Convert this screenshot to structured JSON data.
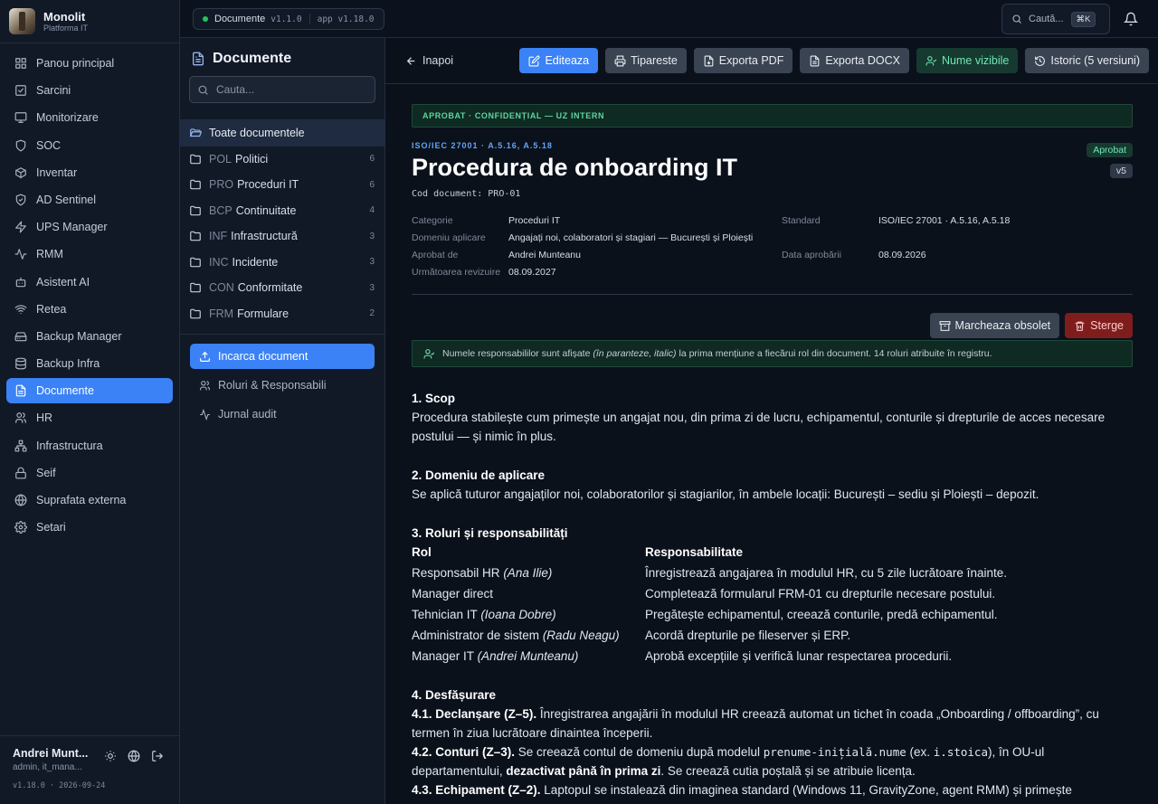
{
  "brand": {
    "name": "Monolit",
    "subtitle": "Platforma IT"
  },
  "nav": [
    {
      "label": "Panou principal",
      "icon": "grid-icon"
    },
    {
      "label": "Sarcini",
      "icon": "checkbox-icon"
    },
    {
      "label": "Monitorizare",
      "icon": "monitor-icon"
    },
    {
      "label": "SOC",
      "icon": "shield-icon"
    },
    {
      "label": "Inventar",
      "icon": "box-icon"
    },
    {
      "label": "AD Sentinel",
      "icon": "shield-check-icon"
    },
    {
      "label": "UPS Manager",
      "icon": "zap-icon"
    },
    {
      "label": "RMM",
      "icon": "activity-icon"
    },
    {
      "label": "Asistent AI",
      "icon": "bot-icon"
    },
    {
      "label": "Retea",
      "icon": "wifi-icon"
    },
    {
      "label": "Backup Manager",
      "icon": "hard-drive-icon"
    },
    {
      "label": "Backup Infra",
      "icon": "database-icon"
    },
    {
      "label": "Documente",
      "icon": "document-icon",
      "active": true
    },
    {
      "label": "HR",
      "icon": "users-icon"
    },
    {
      "label": "Infrastructura",
      "icon": "network-icon"
    },
    {
      "label": "Seif",
      "icon": "lock-icon"
    },
    {
      "label": "Suprafata externa",
      "icon": "globe-icon"
    },
    {
      "label": "Setari",
      "icon": "gear-icon"
    }
  ],
  "user": {
    "name": "Andrei Munt...",
    "role": "admin, it_mana...",
    "version": "v1.18.0 · 2026-09-24"
  },
  "topbar": {
    "section": "Documente",
    "module_version": "v1.1.0",
    "app_version": "app v1.18.0",
    "search_placeholder": "Caută...",
    "shortcut": "⌘K"
  },
  "panel": {
    "title": "Documente",
    "search_placeholder": "Cauta...",
    "all_label": "Toate documentele",
    "folders": [
      {
        "prefix": "POL",
        "name": "Politici",
        "count": "6"
      },
      {
        "prefix": "PRO",
        "name": "Proceduri IT",
        "count": "6"
      },
      {
        "prefix": "BCP",
        "name": "Continuitate",
        "count": "4"
      },
      {
        "prefix": "INF",
        "name": "Infrastructură",
        "count": "3"
      },
      {
        "prefix": "INC",
        "name": "Incidente",
        "count": "3"
      },
      {
        "prefix": "CON",
        "name": "Conformitate",
        "count": "3"
      },
      {
        "prefix": "FRM",
        "name": "Formulare",
        "count": "2"
      }
    ],
    "upload_label": "Incarca document",
    "roles_label": "Roluri & Responsabili",
    "audit_label": "Jurnal audit"
  },
  "toolbar": {
    "back": "Inapoi",
    "edit": "Editeaza",
    "print": "Tipareste",
    "pdf": "Exporta PDF",
    "docx": "Exporta DOCX",
    "names": "Nume vizibile",
    "history": "Istoric (5 versiuni)"
  },
  "doc": {
    "banner": "APROBAT · CONFIDENȚIAL — UZ INTERN",
    "iso": "ISO/IEC 27001 · A.5.16, A.5.18",
    "title": "Procedura de onboarding IT",
    "code": "Cod document: PRO-01",
    "status": "Aprobat",
    "version": "v5",
    "meta": {
      "cat_k": "Categorie",
      "cat_v": "Proceduri IT",
      "std_k": "Standard",
      "std_v": "ISO/IEC 27001 · A.5.16, A.5.18",
      "dom_k": "Domeniu aplicare",
      "dom_v": "Angajați noi, colaboratori și stagiari — București și Ploiești",
      "appr_k": "Aprobat de",
      "appr_v": "Andrei Munteanu",
      "date_k": "Data aprobării",
      "date_v": "08.09.2026",
      "next_k": "Următoarea revizuire",
      "next_v": "08.09.2027"
    },
    "obsolete": "Marcheaza obsolet",
    "delete": "Sterge",
    "info_a": "Numele responsabililor sunt afișate ",
    "info_i": "(în paranteze, italic)",
    "info_b": " la prima mențiune a fiecărui rol din document. 14 roluri atribuite în registru.",
    "s1_h": "1. Scop",
    "s1_t": "Procedura stabilește cum primește un angajat nou, din prima zi de lucru, echipamentul, conturile și drepturile de acces necesare postului — și nimic în plus.",
    "s2_h": "2. Domeniu de aplicare",
    "s2_t": "Se aplică tuturor angajaților noi, colaboratorilor și stagiarilor, în ambele locații: București – sediu și Ploiești – depozit.",
    "s3_h": "3. Roluri și responsabilități",
    "roles_h1": "Rol",
    "roles_h2": "Responsabilitate",
    "roles": [
      {
        "role": "Responsabil HR",
        "person": "(Ana Ilie)",
        "resp": "Înregistrează angajarea în modulul HR, cu 5 zile lucrătoare înainte."
      },
      {
        "role": "Manager direct",
        "person": "",
        "resp": "Completează formularul FRM-01 cu drepturile necesare postului."
      },
      {
        "role": "Tehnician IT",
        "person": "(Ioana Dobre)",
        "resp": "Pregătește echipamentul, creează conturile, predă echipamentul."
      },
      {
        "role": "Administrator de sistem",
        "person": "(Radu Neagu)",
        "resp": "Acordă drepturile pe fileserver și ERP."
      },
      {
        "role": "Manager IT",
        "person": "(Andrei Munteanu)",
        "resp": "Aprobă excepțiile și verifică lunar respectarea procedurii."
      }
    ],
    "s4_h": "4. Desfășurare",
    "s41_h": "4.1. Declanșare (Z–5).",
    "s41_t": " Înregistrarea angajării în modulul HR creează automat un tichet în coada „Onboarding / offboarding”, cu termen în ziua lucrătoare dinaintea începerii.",
    "s42_h": "4.2. Conturi (Z–3).",
    "s42_a": " Se creează contul de domeniu după modelul ",
    "s42_c1": "prenume-inițială.nume",
    "s42_b": " (ex. ",
    "s42_c2": "i.stoica",
    "s42_c": "), în OU-ul departamentului, ",
    "s42_bold": "dezactivat până în prima zi",
    "s42_d": ". Se creează cutia poștală și se atribuie licența.",
    "s43_h": "4.3. Echipament (Z–2).",
    "s43_t": " Laptopul se instalează din imaginea standard (Windows 11, GravityZone, agent RMM) și primește"
  }
}
